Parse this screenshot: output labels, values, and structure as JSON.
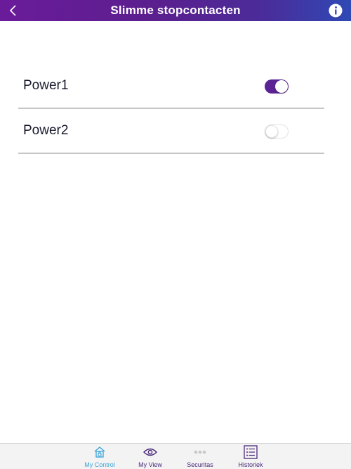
{
  "header": {
    "title": "Slimme stopcontacten",
    "back_icon": "chevron-left-icon",
    "info_icon": "info-icon"
  },
  "switches": [
    {
      "label": "Power1",
      "state": "on"
    },
    {
      "label": "Power2",
      "state": "off"
    }
  ],
  "tabbar": {
    "tabs": [
      {
        "label": "My Control",
        "icon": "home-lock-icon",
        "active": true
      },
      {
        "label": "My View",
        "icon": "eye-icon",
        "active": false
      },
      {
        "label": "Securitas",
        "icon": "dots-icon",
        "active": false
      },
      {
        "label": "Historiek",
        "icon": "list-icon",
        "active": false
      }
    ]
  },
  "colors": {
    "header_gradient_start": "#6a1b9a",
    "header_gradient_end": "#2f49b5",
    "toggle_on": "#5b2393",
    "tab_active": "#3aa3d8",
    "tab_inactive": "#4a2a7a"
  }
}
